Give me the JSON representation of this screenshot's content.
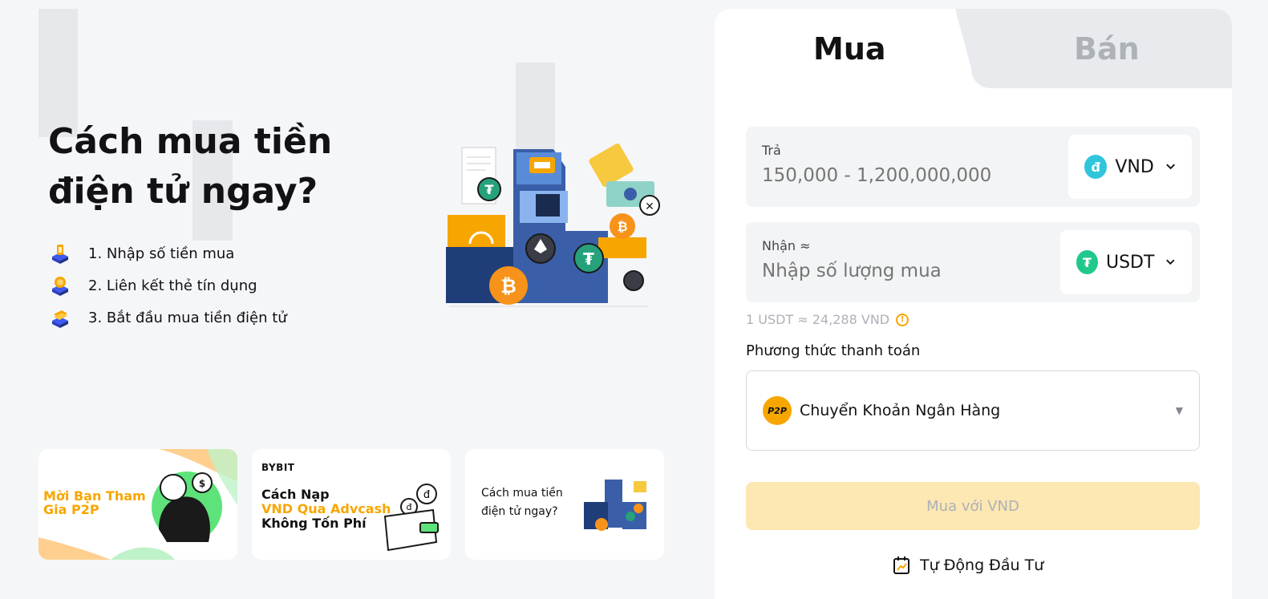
{
  "hero": {
    "title": "Cách mua tiền điện tử ngay?",
    "steps": [
      {
        "label": "1. Nhập số tiền mua",
        "icon": "coin-stack-icon"
      },
      {
        "label": "2. Liên kết thẻ tín dụng",
        "icon": "coin-card-icon"
      },
      {
        "label": "3. Bắt đầu mua tiền điện tử",
        "icon": "card-stack-icon"
      }
    ]
  },
  "banners": [
    {
      "title": "Mời Bạn Tham Gia P2P"
    },
    {
      "logo": "BYBIT",
      "line1": "Cách Nạp",
      "line2": "VND Qua Advcash",
      "line3": "Không Tốn Phí"
    },
    {
      "title": "Cách mua tiền điện tử ngay?"
    }
  ],
  "panel": {
    "tabs": {
      "buy": "Mua",
      "sell": "Bán"
    },
    "pay": {
      "label": "Trả",
      "placeholder": "150,000 - 1,200,000,000",
      "currency": "VND",
      "currency_icon": "đ"
    },
    "receive": {
      "label": "Nhận ≈",
      "placeholder": "Nhập số lượng mua",
      "currency": "USDT",
      "currency_icon": "₮"
    },
    "rate": "1 USDT ≈ 24,288 VND",
    "payment_method_label": "Phương thức thanh toán",
    "payment_method": {
      "icon_text": "P2P",
      "value": "Chuyển Khoản Ngân Hàng"
    },
    "buy_button": "Mua với VND",
    "auto_invest": "Tự Động Đầu Tư"
  },
  "colors": {
    "accent": "#f7a600",
    "usdt": "#26a17b",
    "vnd": "#2fc6dc",
    "bitcoin": "#f7931a"
  }
}
